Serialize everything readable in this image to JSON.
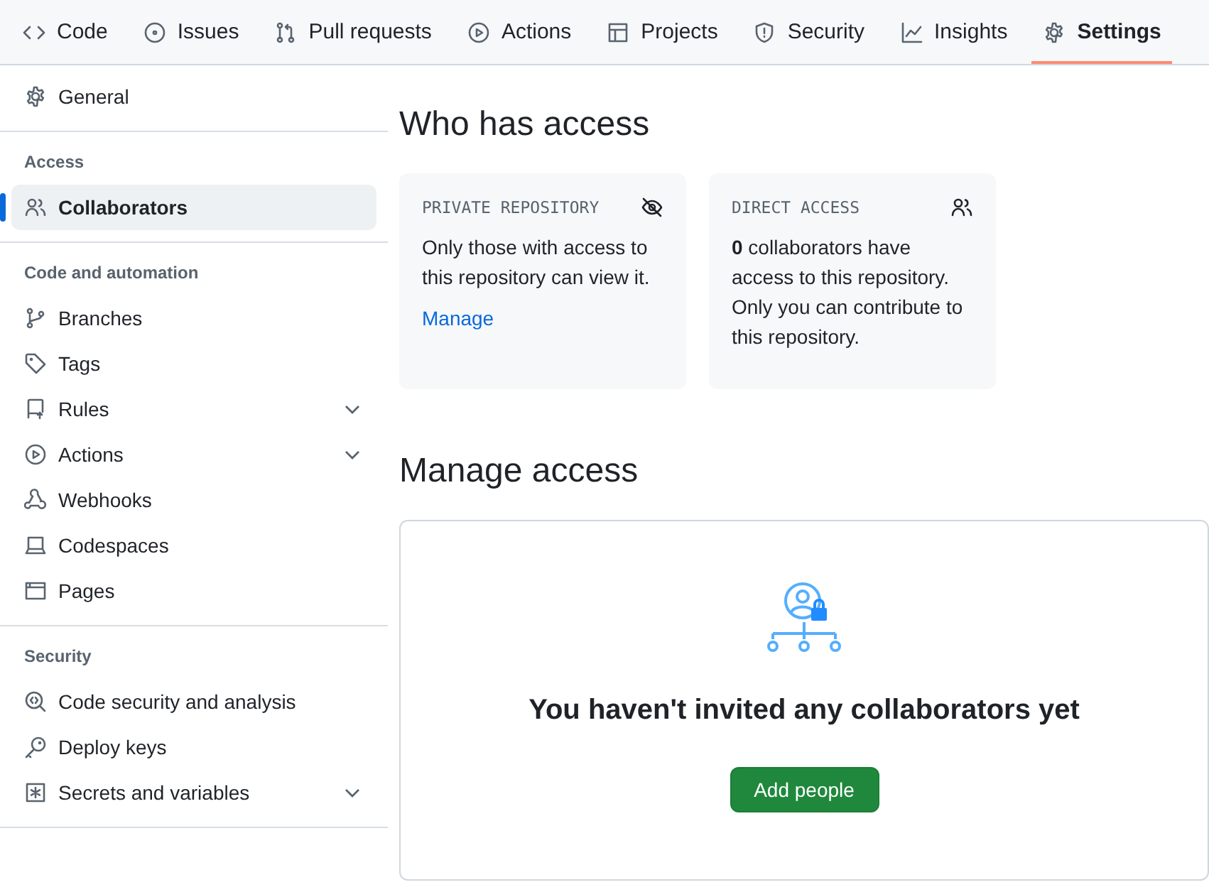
{
  "nav": {
    "tabs": [
      {
        "label": "Code",
        "selected": false
      },
      {
        "label": "Issues",
        "selected": false
      },
      {
        "label": "Pull requests",
        "selected": false
      },
      {
        "label": "Actions",
        "selected": false
      },
      {
        "label": "Projects",
        "selected": false
      },
      {
        "label": "Security",
        "selected": false
      },
      {
        "label": "Insights",
        "selected": false
      },
      {
        "label": "Settings",
        "selected": true
      }
    ]
  },
  "sidebar": {
    "sections": [
      {
        "items": [
          {
            "label": "General",
            "kind": "link",
            "selected": false
          }
        ]
      },
      {
        "heading": "Access",
        "items": [
          {
            "label": "Collaborators",
            "kind": "link",
            "selected": true
          }
        ]
      },
      {
        "heading": "Code and automation",
        "items": [
          {
            "label": "Branches",
            "kind": "link",
            "selected": false
          },
          {
            "label": "Tags",
            "kind": "link",
            "selected": false
          },
          {
            "label": "Rules",
            "kind": "menu",
            "selected": false
          },
          {
            "label": "Actions",
            "kind": "menu",
            "selected": false
          },
          {
            "label": "Webhooks",
            "kind": "link",
            "selected": false
          },
          {
            "label": "Codespaces",
            "kind": "link",
            "selected": false
          },
          {
            "label": "Pages",
            "kind": "link",
            "selected": false
          }
        ]
      },
      {
        "heading": "Security",
        "items": [
          {
            "label": "Code security and analysis",
            "kind": "link",
            "selected": false
          },
          {
            "label": "Deploy keys",
            "kind": "link",
            "selected": false
          },
          {
            "label": "Secrets and variables",
            "kind": "menu",
            "selected": false
          }
        ]
      }
    ]
  },
  "who_has_access": {
    "title": "Who has access",
    "cards": [
      {
        "kind": "visibility",
        "heading": "PRIVATE REPOSITORY",
        "text": "Only those with access to this repository can view it.",
        "link": "Manage"
      },
      {
        "kind": "collaborators",
        "heading": "DIRECT ACCESS",
        "text": "**0** collaborators have access to this repository. Only you can contribute to this repository."
      }
    ]
  },
  "manage_access": {
    "title": "Manage access",
    "empty_message": "You haven't invited any collaborators yet",
    "button": "Add people"
  }
}
